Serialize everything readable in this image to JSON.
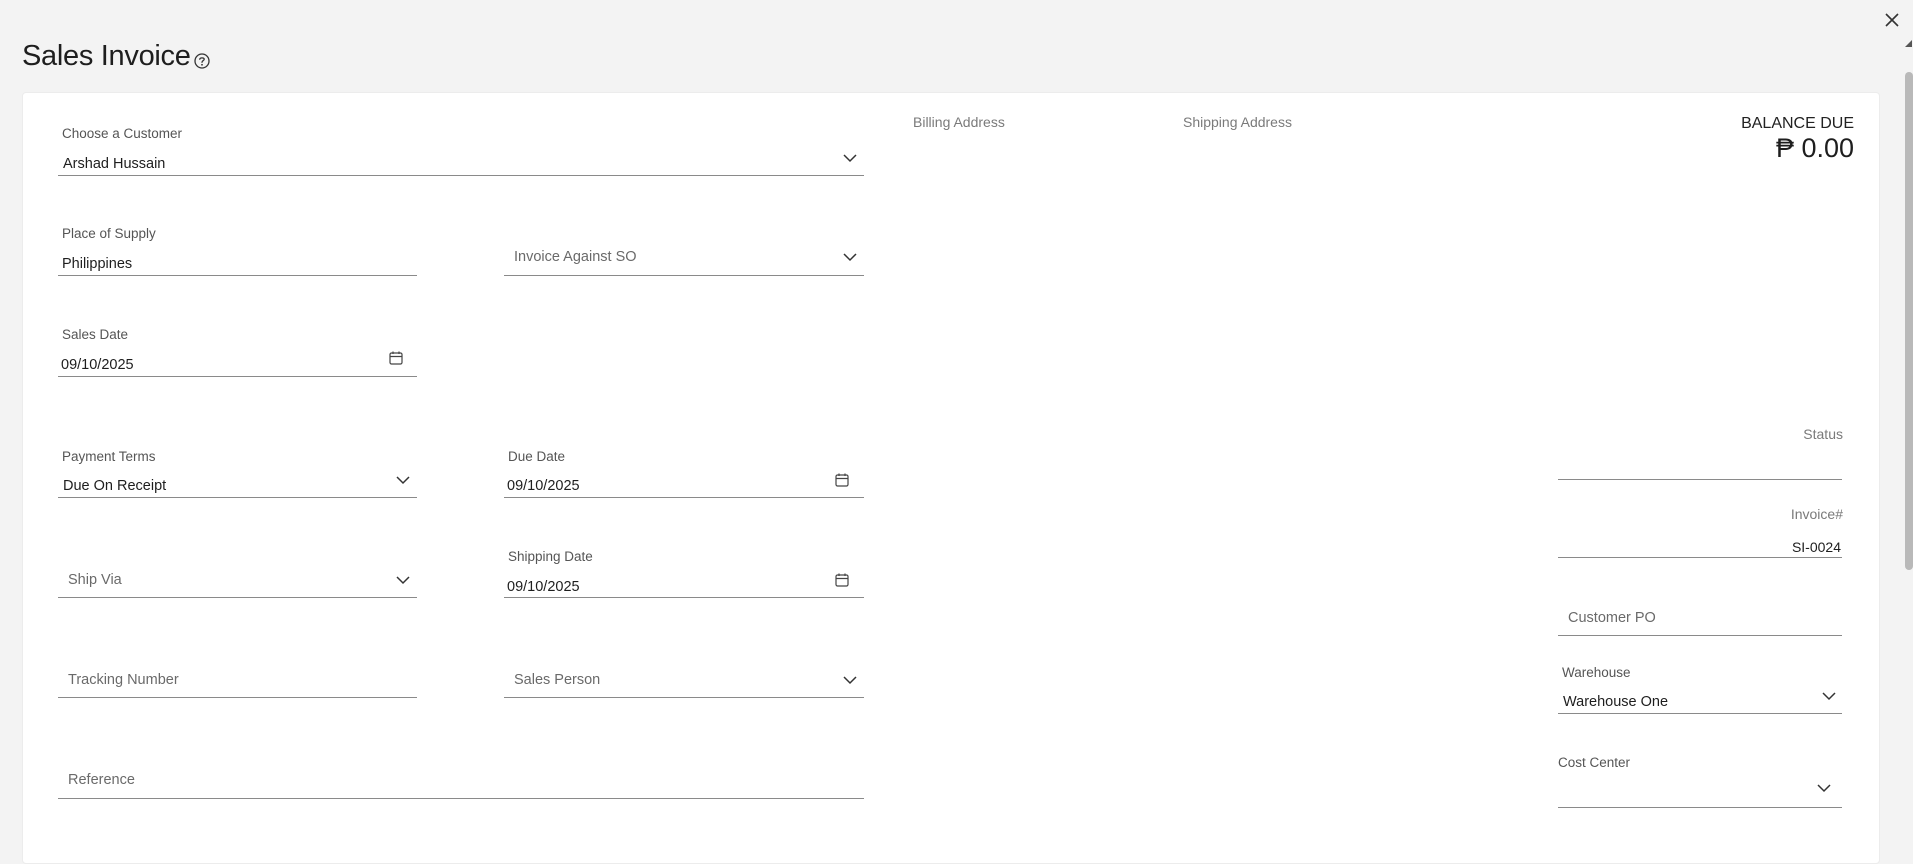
{
  "header": {
    "title": "Sales Invoice",
    "help_icon": "help-circle-icon",
    "close_icon": "close-icon"
  },
  "customer": {
    "label": "Choose a Customer",
    "value": "Arshad Hussain"
  },
  "place_of_supply": {
    "label": "Place of Supply",
    "value": "Philippines"
  },
  "invoice_against_so": {
    "placeholder": "Invoice Against SO"
  },
  "sales_date": {
    "label": "Sales Date",
    "value": "09/10/2025"
  },
  "payment_terms": {
    "label": "Payment Terms",
    "value": "Due On Receipt"
  },
  "due_date": {
    "label": "Due Date",
    "value": "09/10/2025"
  },
  "ship_via": {
    "placeholder": "Ship Via"
  },
  "shipping_date": {
    "label": "Shipping Date",
    "value": "09/10/2025"
  },
  "tracking_number": {
    "placeholder": "Tracking Number"
  },
  "sales_person": {
    "placeholder": "Sales Person"
  },
  "reference": {
    "placeholder": "Reference"
  },
  "addresses": {
    "billing_label": "Billing Address",
    "shipping_label": "Shipping Address"
  },
  "balance": {
    "label": "BALANCE DUE",
    "amount": "₱ 0.00"
  },
  "status": {
    "label": "Status",
    "value": ""
  },
  "invoice_number": {
    "label": "Invoice#",
    "value": "SI-0024"
  },
  "customer_po": {
    "placeholder": "Customer PO"
  },
  "warehouse": {
    "label": "Warehouse",
    "value": "Warehouse One"
  },
  "cost_center": {
    "label": "Cost Center",
    "value": ""
  },
  "icons": {
    "dropdown": "chevron-down-icon",
    "date": "calendar-icon"
  }
}
